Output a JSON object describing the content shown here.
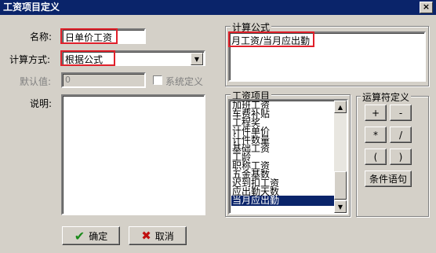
{
  "window": {
    "title": "工资项目定义",
    "close_glyph": "×"
  },
  "form": {
    "name_label": "名称:",
    "name_value": "日单价工资",
    "calc_label": "计算方式:",
    "calc_value": "根据公式",
    "default_label": "默认值:",
    "default_value": "0",
    "system_define_label": "系统定义",
    "desc_label": "说明:"
  },
  "formula": {
    "group_title": "计算公式",
    "value": "月工资/当月应出勤"
  },
  "salary_items": {
    "group_title": "工资项目",
    "items": [
      "加班工资",
      "车费补贴",
      "工程奖",
      "计件单价",
      "计件数量",
      "基础工资",
      "工龄",
      "职称工资",
      "五金基数",
      "迟到扣工资",
      "应出勤天数",
      "当月应出勤"
    ],
    "selected": "当月应出勤"
  },
  "operators": {
    "group_title": "运算符定义",
    "plus": "+",
    "minus": "-",
    "multiply": "*",
    "divide": "/",
    "lparen": "(",
    "rparen": ")",
    "condition": "条件语句"
  },
  "buttons": {
    "ok": "确定",
    "cancel": "取消"
  },
  "colors": {
    "title_bar": "#0a246a",
    "highlight": "#e0202a",
    "selection": "#0a246a"
  }
}
